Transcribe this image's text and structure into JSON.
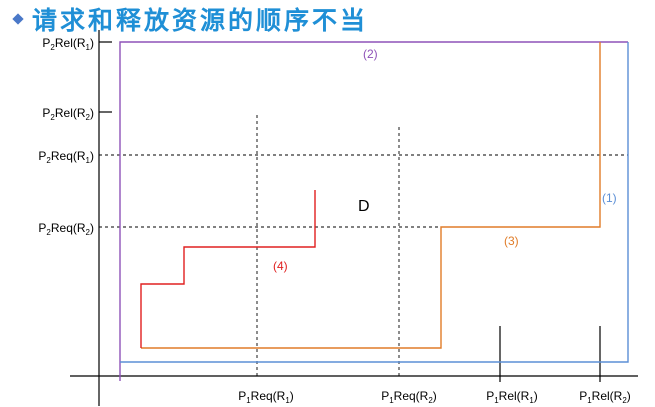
{
  "title": "请求和释放资源的顺序不当",
  "y_labels": {
    "p2rel_r1": {
      "p": "P",
      "ps": "2",
      "t": "Rel(R",
      "rs": "1",
      "end": ")"
    },
    "p2rel_r2": {
      "p": "P",
      "ps": "2",
      "t": "Rel(R",
      "rs": "2",
      "end": ")"
    },
    "p2req_r1": {
      "p": "P",
      "ps": "2",
      "t": "Req(R",
      "rs": "1",
      "end": ")"
    },
    "p2req_r2": {
      "p": "P",
      "ps": "2",
      "t": "Req(R",
      "rs": "2",
      "end": ")"
    }
  },
  "x_labels": {
    "p1req_r1": {
      "p": "P",
      "ps": "1",
      "t": "Req(R",
      "rs": "1",
      "end": ")"
    },
    "p1req_r2": {
      "p": "P",
      "ps": "1",
      "t": "Req(R",
      "rs": "2",
      "end": ")"
    },
    "p1rel_r1": {
      "p": "P",
      "ps": "1",
      "t": "Rel(R",
      "rs": "1",
      "end": ")"
    },
    "p1rel_r2": {
      "p": "P",
      "ps": "1",
      "t": "Rel(R",
      "rs": "2",
      "end": ")"
    }
  },
  "paths": {
    "p1": {
      "label": "(1)",
      "color": "#5b8fd6"
    },
    "p2": {
      "label": "(2)",
      "color": "#8e52b8"
    },
    "p3": {
      "label": "(3)",
      "color": "#e07c28"
    },
    "p4": {
      "label": "(4)",
      "color": "#e02020"
    }
  },
  "region_label": "D"
}
